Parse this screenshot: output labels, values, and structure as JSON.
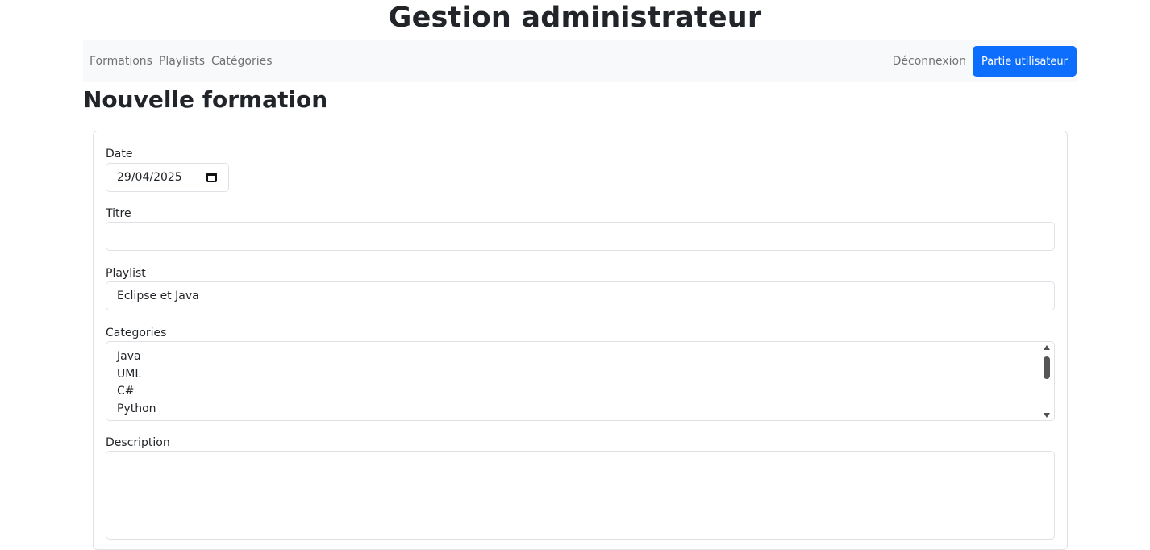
{
  "header": {
    "app_title": "Gestion administrateur"
  },
  "nav": {
    "links": [
      "Formations",
      "Playlists",
      "Catégories"
    ],
    "logout_label": "Déconnexion",
    "user_button_label": "Partie utilisateur",
    "accent_color": "#0d6efd"
  },
  "page": {
    "title": "Nouvelle formation"
  },
  "form": {
    "date": {
      "label": "Date",
      "value": "29/04/2025",
      "icon": "calendar-icon"
    },
    "titre": {
      "label": "Titre",
      "value": ""
    },
    "playlist": {
      "label": "Playlist",
      "value": "Eclipse et Java"
    },
    "categories": {
      "label": "Categories",
      "options": [
        "Java",
        "UML",
        "C#",
        "Python"
      ]
    },
    "description": {
      "label": "Description",
      "value": ""
    }
  }
}
